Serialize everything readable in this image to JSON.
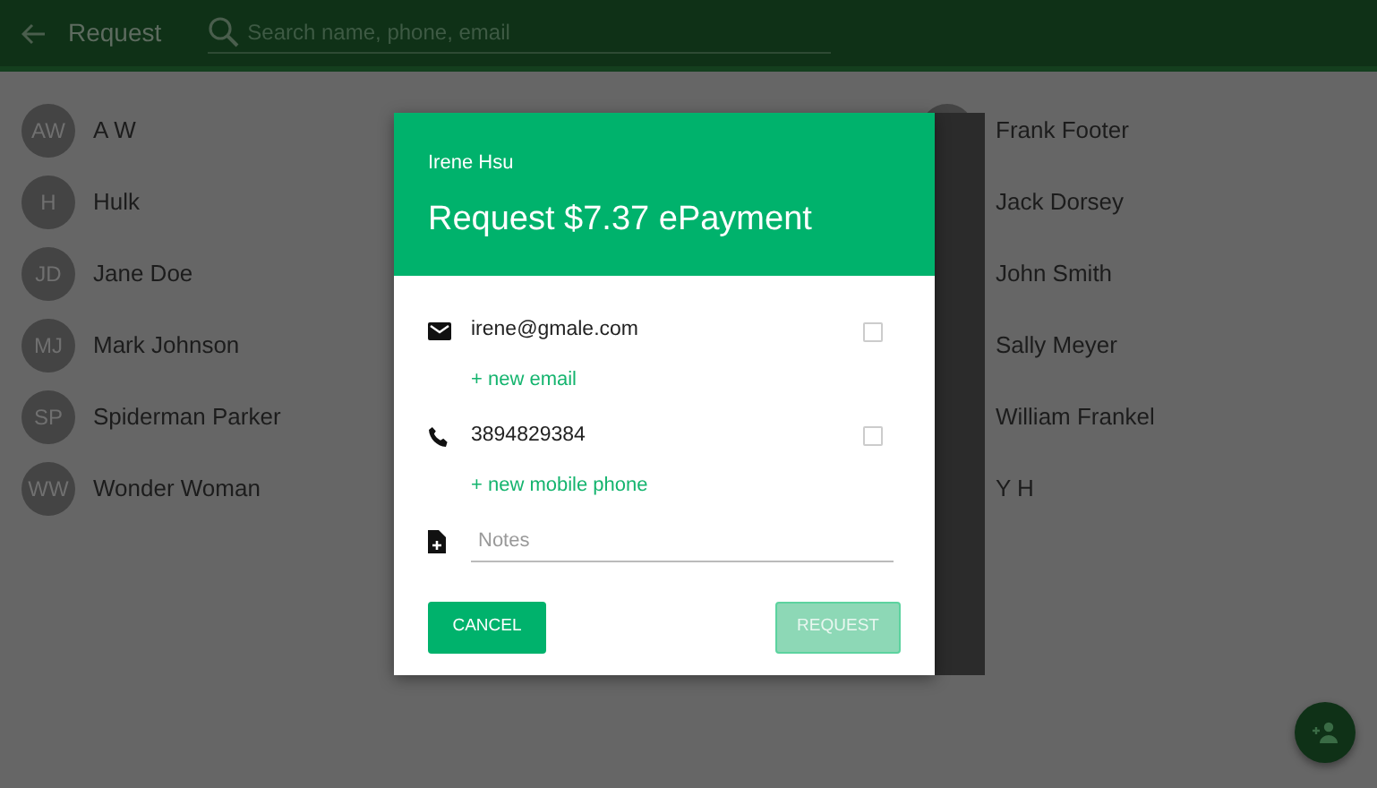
{
  "toolbar": {
    "title": "Request",
    "search": {
      "placeholder": "Search name, phone, email"
    }
  },
  "contacts_left": [
    {
      "initials": "AW",
      "name": "A W"
    },
    {
      "initials": "H",
      "name": "Hulk"
    },
    {
      "initials": "JD",
      "name": "Jane Doe"
    },
    {
      "initials": "MJ",
      "name": "Mark Johnson"
    },
    {
      "initials": "SP",
      "name": "Spiderman Parker"
    },
    {
      "initials": "WW",
      "name": "Wonder Woman"
    }
  ],
  "contacts_right": [
    {
      "name": "Frank Footer",
      "avatar": true
    },
    {
      "name": "Jack Dorsey"
    },
    {
      "name": "John Smith"
    },
    {
      "name": "Sally Meyer"
    },
    {
      "name": "William Frankel"
    },
    {
      "name": "Y H"
    }
  ],
  "dialog": {
    "subtitle": "Irene Hsu",
    "title": "Request $7.37 ePayment",
    "contact_rows": [
      {
        "kind": "email",
        "value": "irene@gmale.com",
        "checked": false,
        "add_link": "+ new email"
      },
      {
        "kind": "phone",
        "value": "3894829384",
        "checked": false,
        "add_link": "+ new mobile phone"
      }
    ],
    "notes": {
      "placeholder": "Notes"
    },
    "cancel_button": "CANCEL",
    "request_button": {
      "label": "REQUEST",
      "disabled": true
    }
  }
}
